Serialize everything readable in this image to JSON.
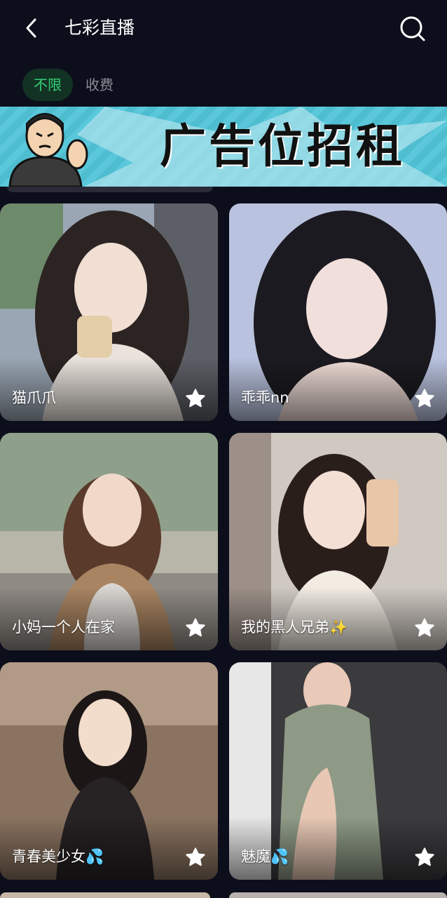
{
  "header": {
    "title": "七彩直播"
  },
  "tabs": [
    {
      "label": "不限",
      "active": true
    },
    {
      "label": "收费",
      "active": false
    }
  ],
  "banner": {
    "text": "广告位招租"
  },
  "cards": [
    {
      "name": "猫爪爪",
      "favorite": true
    },
    {
      "name": "乖乖nn",
      "favorite": true
    },
    {
      "name": "小妈一个人在家",
      "favorite": true
    },
    {
      "name": "我的黑人兄弟✨",
      "favorite": true
    },
    {
      "name": "青春美少女💦",
      "favorite": true
    },
    {
      "name": "魅魔💦",
      "favorite": true
    }
  ],
  "colors": {
    "background": "#0d0e1c",
    "tab_active_bg": "#123323",
    "tab_active_text": "#34d17a",
    "tab_inactive_text": "#8a8c96",
    "banner_bg": "#5ac8da"
  }
}
